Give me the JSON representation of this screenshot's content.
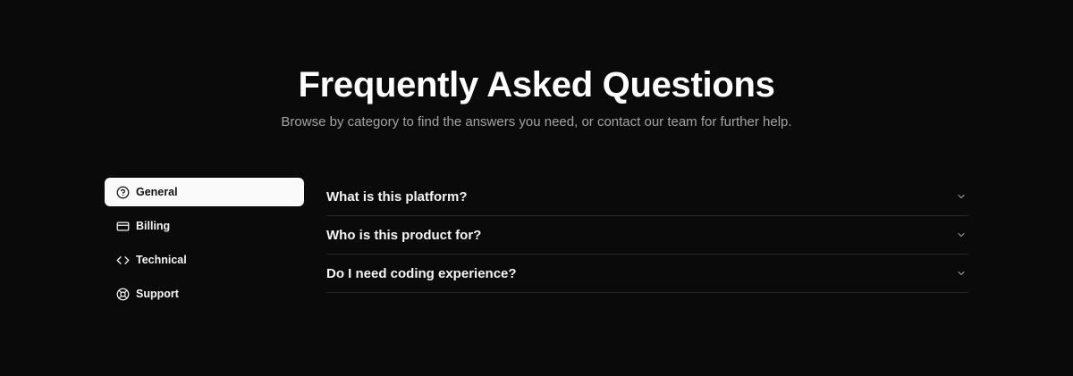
{
  "header": {
    "title": "Frequently Asked Questions",
    "subtitle": "Browse by category to find the answers you need, or contact our team for further help."
  },
  "sidebar": {
    "active_index": 0,
    "items": [
      {
        "label": "General",
        "icon": "help-circle-icon"
      },
      {
        "label": "Billing",
        "icon": "credit-card-icon"
      },
      {
        "label": "Technical",
        "icon": "code-icon"
      },
      {
        "label": "Support",
        "icon": "life-buoy-icon"
      }
    ]
  },
  "faq": {
    "items": [
      {
        "question": "What is this platform?",
        "icon": "chevron-down-icon"
      },
      {
        "question": "Who is this product for?",
        "icon": "chevron-down-icon"
      },
      {
        "question": "Do I need coding experience?",
        "icon": "chevron-down-icon"
      }
    ]
  },
  "colors": {
    "background": "#0a0a0a",
    "text_primary": "#fafafa",
    "text_muted": "#a3a3a3",
    "active_bg": "#fafafa",
    "divider": "#262626"
  }
}
